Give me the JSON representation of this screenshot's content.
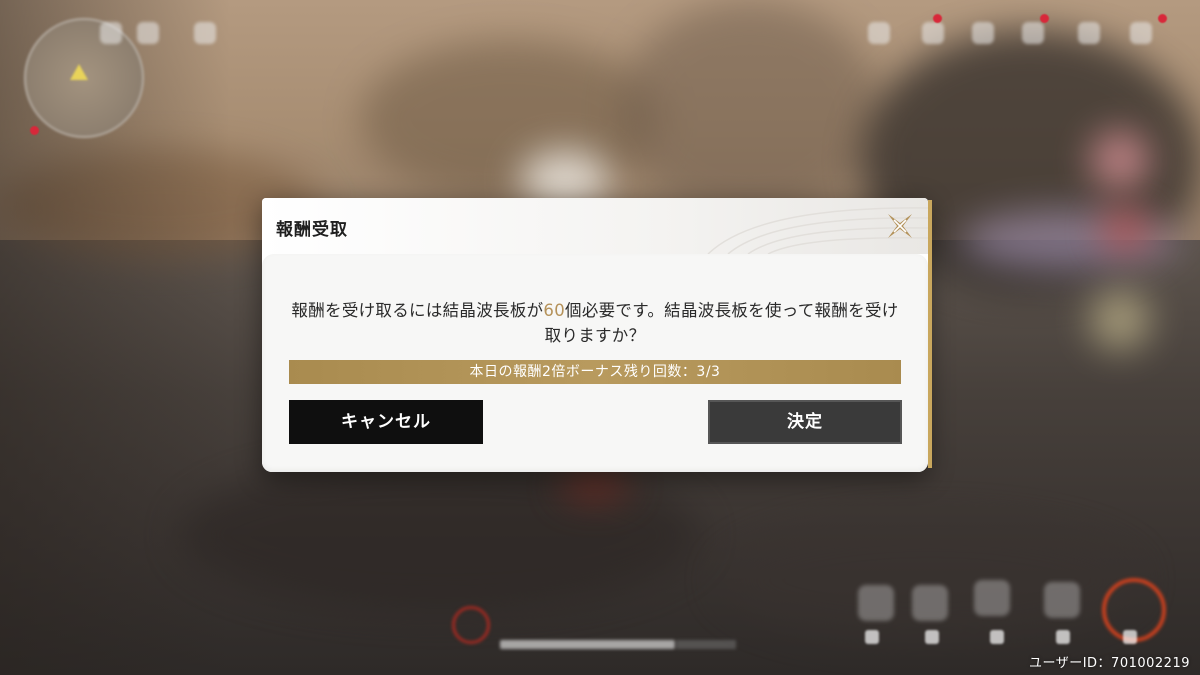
{
  "dialog": {
    "title": "報酬受取",
    "message": {
      "part1": "報酬を受け取るには結晶波長板が",
      "count": "60",
      "part2": "個必要です。結晶波長板を使って報酬を受け取りますか？"
    },
    "bonus": "本日の報酬2倍ボーナス残り回数：3/3",
    "cancel_label": "キャンセル",
    "confirm_label": "決定"
  },
  "footer": {
    "user_id": "ユーザーID：701002219"
  },
  "colors": {
    "accent_gold": "#b5925a",
    "banner_gold": "#a98b4f",
    "cancel_bg": "#0f0f0f",
    "confirm_bg": "#3a3a3a"
  },
  "icons": [
    "close-icon",
    "minimap-player-arrow-icon"
  ]
}
